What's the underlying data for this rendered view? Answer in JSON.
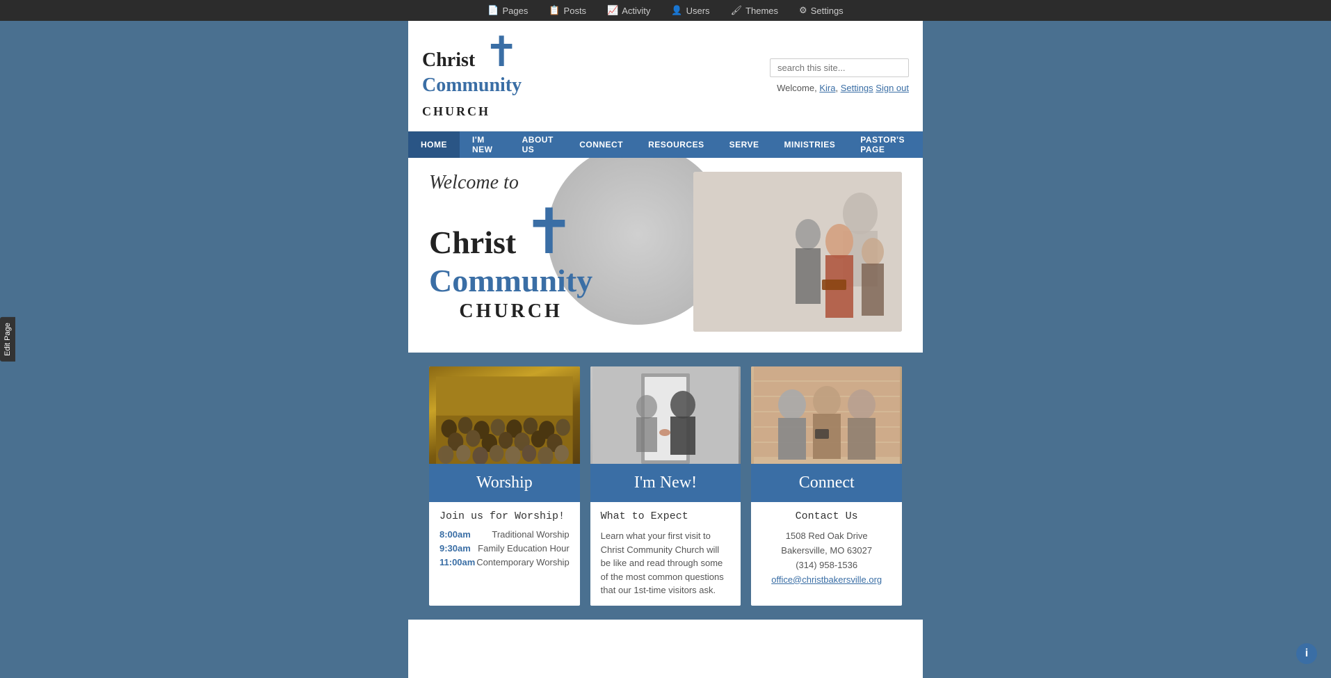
{
  "admin_bar": {
    "items": [
      {
        "label": "Pages",
        "icon": "📄"
      },
      {
        "label": "Posts",
        "icon": "📋"
      },
      {
        "label": "Activity",
        "icon": "📈"
      },
      {
        "label": "Users",
        "icon": "👤"
      },
      {
        "label": "Themes",
        "icon": "🖌"
      },
      {
        "label": "Settings",
        "icon": "⚙"
      }
    ]
  },
  "edit_page_tab": "Edit Page",
  "header": {
    "logo": {
      "christ": "Christ",
      "community": "Community",
      "church": "CHURCH"
    },
    "search_placeholder": "search this site...",
    "welcome_text": "Welcome,",
    "user_name": "Kira",
    "settings_link": "Settings",
    "signout_link": "Sign out"
  },
  "nav": {
    "items": [
      {
        "label": "HOME",
        "active": true
      },
      {
        "label": "I'M NEW",
        "active": false
      },
      {
        "label": "ABOUT US",
        "active": false
      },
      {
        "label": "CONNECT",
        "active": false
      },
      {
        "label": "RESOURCES",
        "active": false
      },
      {
        "label": "SERVE",
        "active": false
      },
      {
        "label": "MINISTRIES",
        "active": false
      },
      {
        "label": "PASTOR'S PAGE",
        "active": false
      }
    ]
  },
  "hero": {
    "welcome_to": "Welcome to",
    "logo": {
      "christ": "Christ",
      "community": "Community",
      "church": "CHURCH"
    }
  },
  "columns": [
    {
      "id": "worship",
      "label": "Worship",
      "heading": "Join us for Worship!",
      "services": [
        {
          "time": "8:00am",
          "name": "Traditional Worship"
        },
        {
          "time": "9:30am",
          "name": "Family Education Hour"
        },
        {
          "time": "11:00am",
          "name": "Contemporary Worship"
        }
      ]
    },
    {
      "id": "im-new",
      "label": "I'm New!",
      "heading": "What to Expect",
      "body": "Learn what your first visit to Christ Community Church will be like and read through some of the most common questions that our 1st-time visitors ask."
    },
    {
      "id": "connect",
      "label": "Connect",
      "heading": "Contact Us",
      "address_line1": "1508 Red Oak Drive",
      "address_line2": "Bakersville, MO 63027",
      "phone": "(314) 958-1536",
      "email": "office@christbakersville.org"
    }
  ],
  "info_button": "i"
}
